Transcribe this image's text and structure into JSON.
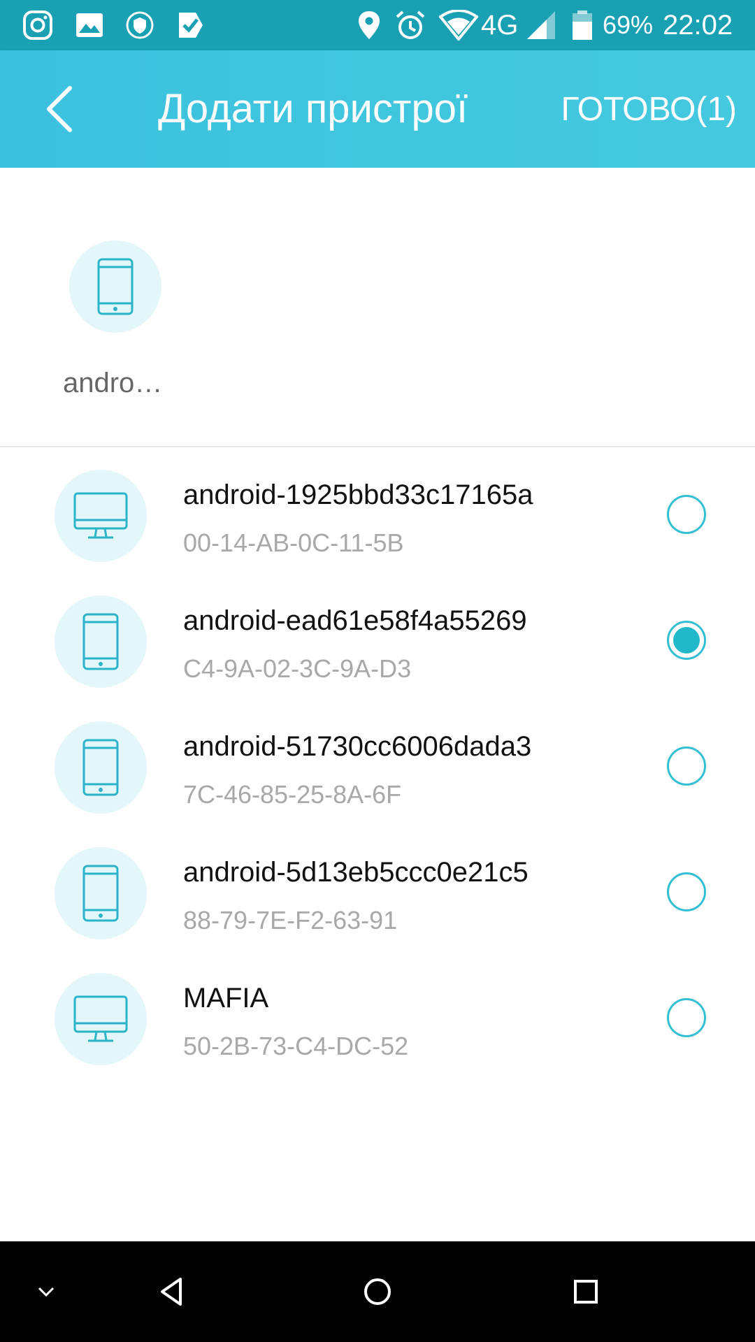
{
  "status_bar": {
    "network": "4G",
    "battery": "69%",
    "time": "22:02",
    "icons_left": [
      "instagram-icon",
      "gallery-icon",
      "shield-icon",
      "tasks-icon"
    ],
    "icons_right": [
      "location-icon",
      "alarm-icon",
      "wifi-icon",
      "signal-icon",
      "battery-icon"
    ]
  },
  "app_bar": {
    "title": "Додати пристрої",
    "done_label": "ГОТОВО(1)"
  },
  "selected": {
    "chips": [
      {
        "label": "androi…",
        "icon": "phone-icon"
      }
    ]
  },
  "devices": [
    {
      "name": "android-1925bbd33c17165a",
      "mac": "00-14-AB-0C-11-5B",
      "icon": "monitor-icon",
      "checked": false
    },
    {
      "name": "android-ead61e58f4a55269",
      "mac": "C4-9A-02-3C-9A-D3",
      "icon": "phone-icon",
      "checked": true
    },
    {
      "name": "android-51730cc6006dada3",
      "mac": "7C-46-85-25-8A-6F",
      "icon": "phone-icon",
      "checked": false
    },
    {
      "name": "android-5d13eb5ccc0e21c5",
      "mac": "88-79-7E-F2-63-91",
      "icon": "phone-icon",
      "checked": false
    },
    {
      "name": "MAFIA",
      "mac": "50-2B-73-C4-DC-52",
      "icon": "monitor-icon",
      "checked": false
    }
  ],
  "colors": {
    "status_bar": "#1aa0b3",
    "app_bar": "#3cc1df",
    "accent": "#22b8cc",
    "avatar_bg": "#e3f6fa"
  },
  "nav_bar": {
    "icons": [
      "chevron-down-icon",
      "nav-back-icon",
      "nav-home-icon",
      "nav-recents-icon"
    ]
  }
}
